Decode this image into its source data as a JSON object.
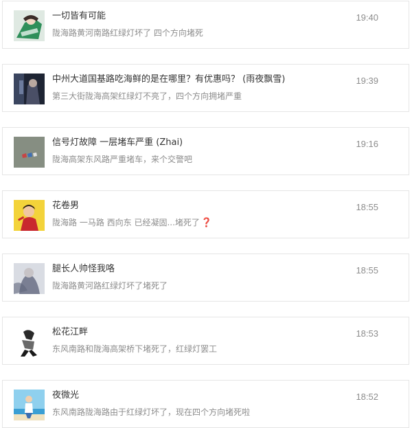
{
  "feed": {
    "items": [
      {
        "avatar": "anime-girl-green-avatar",
        "title": "一切皆有可能",
        "message": "陇海路黄河南路红绿灯坏了 四个方向堵死",
        "time": "19:40"
      },
      {
        "avatar": "dark-portrait-avatar",
        "title": "中州大道国基路吃海鲜的是在哪里？有优惠吗？ (雨夜飘雪)",
        "message": "第三大街陇海高架红绿灯不亮了，四个方向拥堵严重",
        "time": "19:39"
      },
      {
        "avatar": "shoes-on-floor-avatar",
        "title": "信号灯故障 一层堵车严重 (Zhai)",
        "message": "陇海高架东风路严重堵车，来个交警吧",
        "time": "19:16"
      },
      {
        "avatar": "cartoon-man-yellow-avatar",
        "title": "花卷男",
        "message": "陇海路 一马路 西向东 已经凝固...堵死了",
        "message_suffix": "❓",
        "time": "18:55"
      },
      {
        "avatar": "blurred-figure-avatar",
        "title": "腿长人帅怪我咯",
        "message": "陇海路黄河路红绿灯坏了堵死了",
        "time": "18:55"
      },
      {
        "avatar": "monochrome-figure-avatar",
        "title": "松花江畔",
        "message": "东风南路和陇海高架桥下堵死了，红绿灯罢工",
        "time": "18:53"
      },
      {
        "avatar": "beach-person-avatar",
        "title": "夜微光",
        "message": "东风南路陇海路由于红绿灯坏了，现在四个方向堵死啦",
        "time": "18:52"
      }
    ]
  }
}
